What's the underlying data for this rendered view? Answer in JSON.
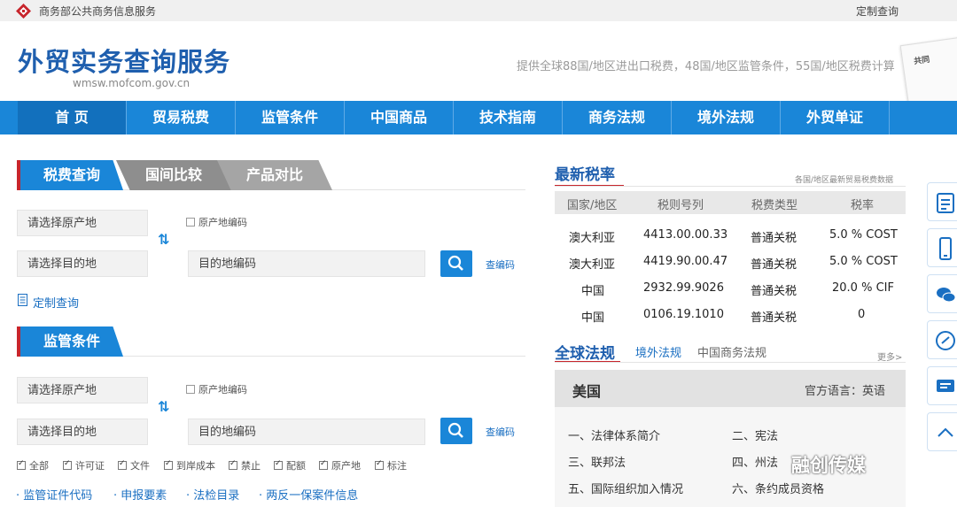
{
  "topbar": {
    "site_name": "商务部公共商务信息服务",
    "custom_query": "定制查询"
  },
  "header": {
    "title": "外贸实务查询服务",
    "domain": "wmsw.mofcom.gov.cn",
    "slogan": "提供全球88国/地区进出口税费，48国/地区监管条件，55国/地区税费计算",
    "book_label": "共同"
  },
  "nav": [
    "首 页",
    "贸易税费",
    "监管条件",
    "中国商品",
    "技术指南",
    "商务法规",
    "境外法规",
    "外贸单证"
  ],
  "tax_section": {
    "tabs": [
      "税费查询",
      "国间比较",
      "产品对比"
    ],
    "origin_placeholder": "请选择原产地",
    "dest_placeholder": "请选择目的地",
    "origin_code_label": "原产地编码",
    "dest_code_placeholder": "目的地编码",
    "lookup_code": "查编码",
    "custom_query": "定制查询"
  },
  "regulation_section": {
    "title": "监管条件",
    "origin_placeholder": "请选择原产地",
    "dest_placeholder": "请选择目的地",
    "origin_code_label": "原产地编码",
    "dest_code_placeholder": "目的地编码",
    "lookup_code": "查编码",
    "filters": [
      "全部",
      "许可证",
      "文件",
      "到岸成本",
      "禁止",
      "配额",
      "原产地",
      "标注"
    ],
    "links": [
      "监管证件代码",
      "申报要素",
      "法检目录",
      "两反一保案件信息"
    ]
  },
  "latest_rates": {
    "title": "最新税率",
    "subtitle": "各国/地区最新贸易税费数据",
    "columns": [
      "国家/地区",
      "税则号列",
      "税费类型",
      "税率"
    ],
    "rows": [
      {
        "country": "澳大利亚",
        "code": "4413.00.00.33",
        "type": "普通关税",
        "rate": "5.0 % COST"
      },
      {
        "country": "澳大利亚",
        "code": "4419.90.00.47",
        "type": "普通关税",
        "rate": "5.0 % COST"
      },
      {
        "country": "中国",
        "code": "2932.99.9026",
        "type": "普通关税",
        "rate": "20.0 % CIF"
      },
      {
        "country": "中国",
        "code": "0106.19.1010",
        "type": "普通关税",
        "rate": "0"
      }
    ]
  },
  "global_law": {
    "title": "全球法规",
    "tabs": [
      "境外法规",
      "中国商务法规"
    ],
    "more": "更多>",
    "country": "美国",
    "official_language": "官方语言：英语",
    "items": [
      "一、法律体系简介",
      "二、宪法",
      "三、联邦法",
      "四、州法",
      "五、国际组织加入情况",
      "六、条约成员资格"
    ]
  },
  "watermark": "融创传媒",
  "colors": {
    "brand_blue": "#1a86d8",
    "title_blue": "#1f5fae",
    "accent_red": "#c7252c"
  }
}
